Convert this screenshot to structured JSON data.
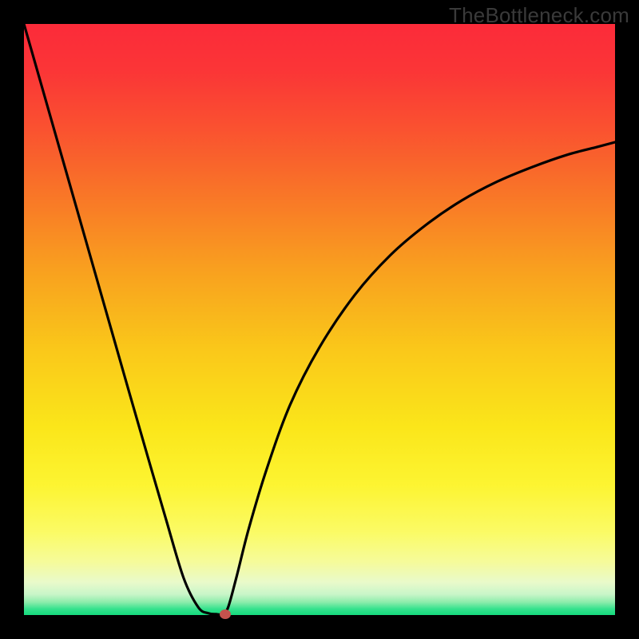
{
  "watermark": "TheBottleneck.com",
  "colors": {
    "gradient_stops": [
      {
        "pos": 0.0,
        "color": "#fc2b3a"
      },
      {
        "pos": 0.08,
        "color": "#fb3637"
      },
      {
        "pos": 0.18,
        "color": "#fa5330"
      },
      {
        "pos": 0.3,
        "color": "#f97a27"
      },
      {
        "pos": 0.42,
        "color": "#f9a21f"
      },
      {
        "pos": 0.55,
        "color": "#fac81a"
      },
      {
        "pos": 0.68,
        "color": "#fbe61a"
      },
      {
        "pos": 0.78,
        "color": "#fdf532"
      },
      {
        "pos": 0.86,
        "color": "#fbfb66"
      },
      {
        "pos": 0.91,
        "color": "#f6fb9b"
      },
      {
        "pos": 0.945,
        "color": "#e9facb"
      },
      {
        "pos": 0.965,
        "color": "#c9f6c9"
      },
      {
        "pos": 0.978,
        "color": "#8eedac"
      },
      {
        "pos": 0.99,
        "color": "#34e28d"
      },
      {
        "pos": 1.0,
        "color": "#15db7e"
      }
    ],
    "curve": "#000000",
    "dot": "#c5524d"
  },
  "chart_data": {
    "type": "line",
    "title": "",
    "xlabel": "",
    "ylabel": "",
    "xlim": [
      0,
      100
    ],
    "ylim": [
      0,
      100
    ],
    "grid": false,
    "legend": false,
    "series": [
      {
        "name": "bottleneck-curve",
        "x": [
          0,
          3,
          6,
          9,
          12,
          15,
          18,
          21,
          24,
          27,
          29.5,
          31.2,
          32.5,
          33.5,
          34.5,
          36,
          38,
          41,
          45,
          50,
          56,
          62,
          68,
          74,
          80,
          86,
          92,
          97,
          100
        ],
        "y": [
          100,
          89.5,
          79,
          68.5,
          58,
          47.5,
          37,
          26.6,
          16.3,
          6.3,
          1.3,
          0.3,
          0.15,
          0.15,
          1.2,
          6.6,
          14.5,
          24.5,
          35.5,
          45.3,
          54.2,
          60.9,
          66.0,
          70.1,
          73.3,
          75.8,
          77.9,
          79.2,
          80.0
        ]
      }
    ],
    "marker": {
      "x": 34.0,
      "y": 0.2
    }
  }
}
